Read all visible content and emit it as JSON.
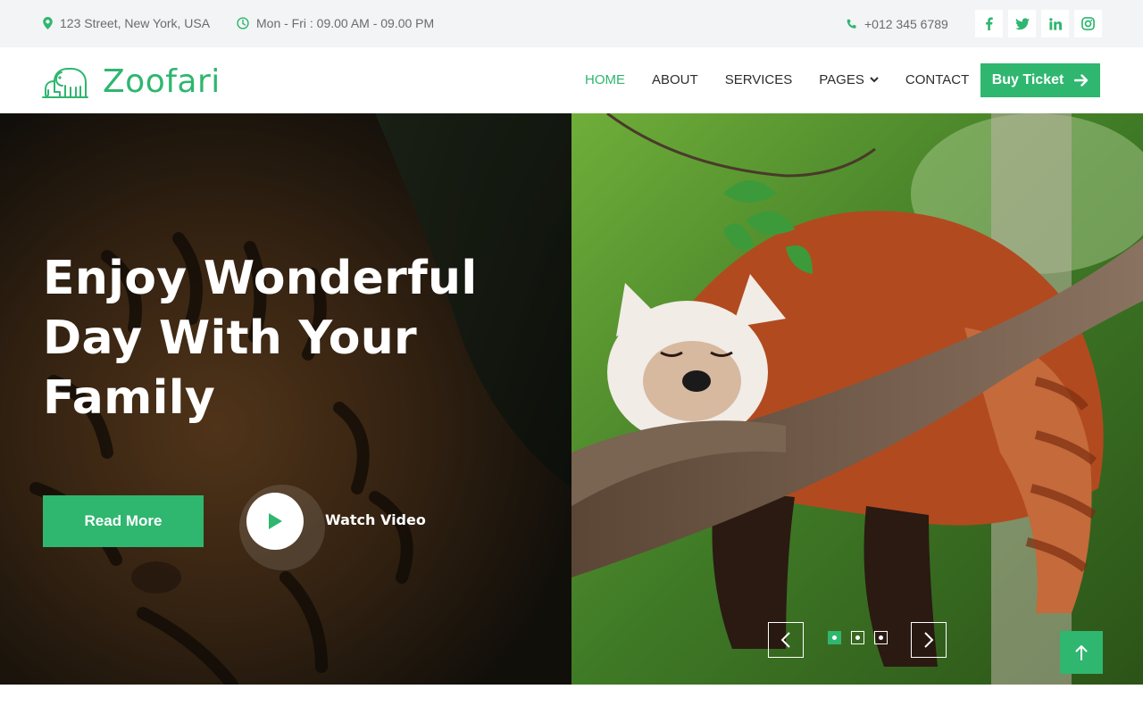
{
  "topbar": {
    "address": "123 Street, New York, USA",
    "hours": "Mon - Fri : 09.00 AM - 09.00 PM",
    "phone": "+012 345 6789",
    "social": [
      "facebook-icon",
      "twitter-icon",
      "linkedin-icon",
      "instagram-icon"
    ]
  },
  "brand": {
    "name": "Zoofari",
    "logo_icon": "elephant-icon"
  },
  "nav": {
    "items": [
      {
        "label": "HOME",
        "active": true
      },
      {
        "label": "ABOUT",
        "active": false
      },
      {
        "label": "SERVICES",
        "active": false
      },
      {
        "label": "PAGES",
        "active": false,
        "dropdown": true
      },
      {
        "label": "CONTACT",
        "active": false
      }
    ],
    "cta": "Buy Ticket"
  },
  "hero": {
    "title": "Enjoy Wonderful Day With Your Family",
    "read_more": "Read More",
    "watch_video": "Watch Video",
    "slides_count": 3,
    "active_slide": 1
  },
  "colors": {
    "accent": "#2fb66f",
    "topbar_bg": "#f3f4f5"
  }
}
